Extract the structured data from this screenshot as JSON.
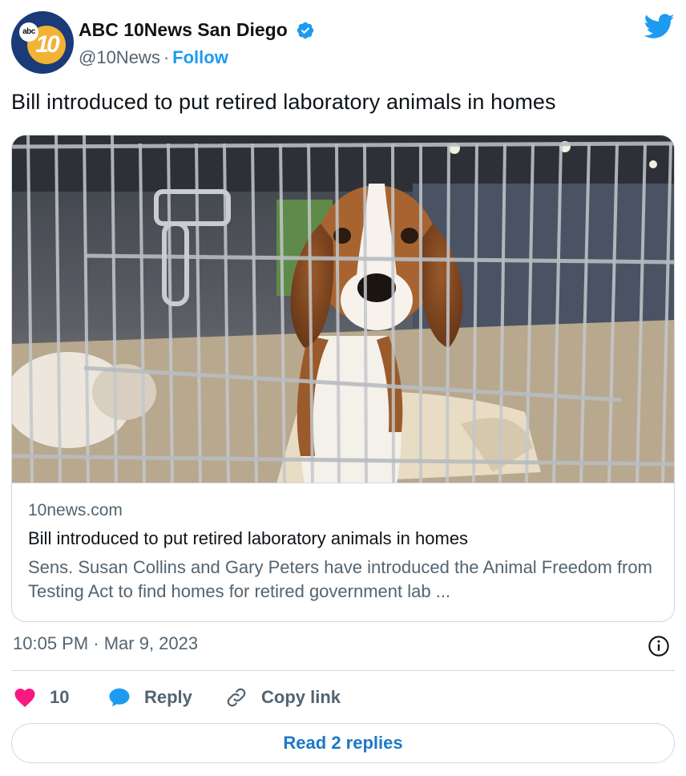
{
  "author": {
    "display_name": "ABC 10News San Diego",
    "handle": "@10News",
    "separator": "·",
    "follow_label": "Follow",
    "avatar_abc_text": "abc",
    "avatar_ten_text": "10"
  },
  "tweet": {
    "text": "Bill introduced to put retired laboratory animals in homes"
  },
  "card": {
    "image_icon": "beagle-in-cage-photo",
    "domain": "10news.com",
    "title": "Bill introduced to put retired laboratory animals in homes",
    "description": "Sens. Susan Collins and Gary Peters have introduced the Animal Freedom from Testing Act to find homes for retired government lab ..."
  },
  "meta": {
    "timestamp": "10:05 PM · Mar 9, 2023"
  },
  "actions": {
    "like_count": "10",
    "reply_label": "Reply",
    "copy_link_label": "Copy link"
  },
  "footer": {
    "read_replies_label": "Read 2 replies"
  },
  "colors": {
    "brand_blue": "#1d9bf0",
    "heart_pink": "#f91880",
    "text_primary": "#0f1419",
    "text_secondary": "#536471",
    "border": "#cfd9de"
  }
}
